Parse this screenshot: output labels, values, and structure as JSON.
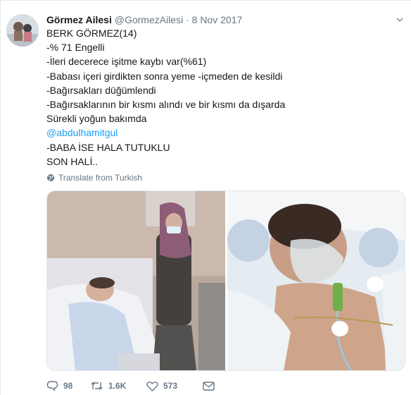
{
  "tweet": {
    "display_name": "Görmez Ailesi",
    "handle": "@GormezAilesi",
    "separator": "·",
    "date": "8 Nov 2017",
    "lines": [
      "BERK GÖRMEZ(14)",
      "-% 71 Engelli",
      "-İleri decerece işitme kaybı var(%61)",
      "-Babası içeri girdikten sonra yeme -içmeden de kesildi",
      "-Bağırsakları düğümlendi",
      "-Bağırsaklarının bir kısmı alındı ve bir kısmı da dışarda",
      "Sürekli yoğun bakımda",
      "@abdulhamitgul",
      "-BABA İSE HALA TUTUKLU",
      "SON HALİ.."
    ],
    "translate_label": "Translate from Turkish",
    "actions": {
      "replies": "98",
      "retweets": "1.6K",
      "likes": "573"
    }
  },
  "icons": {
    "reply": "reply-icon",
    "retweet": "retweet-icon",
    "like": "heart-icon",
    "dm": "envelope-icon",
    "translate": "globe-icon",
    "menu": "chevron-down-icon"
  },
  "colors": {
    "mention": "#1da1f2",
    "meta": "#657786",
    "text": "#14171a",
    "border": "#e1e8ed"
  }
}
